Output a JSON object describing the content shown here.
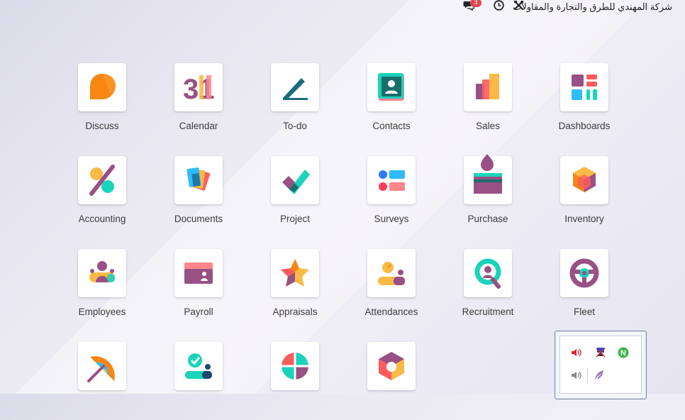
{
  "topbar": {
    "chat_badge": "3",
    "company_name": "شركة المهندي للطرق والتجارة والمقاولات"
  },
  "apps": [
    {
      "label": "Discuss"
    },
    {
      "label": "Calendar",
      "icon_text": "31"
    },
    {
      "label": "To-do"
    },
    {
      "label": "Contacts"
    },
    {
      "label": "Sales"
    },
    {
      "label": "Dashboards"
    },
    {
      "label": "Accounting"
    },
    {
      "label": "Documents"
    },
    {
      "label": "Project"
    },
    {
      "label": "Surveys"
    },
    {
      "label": "Purchase"
    },
    {
      "label": "Inventory"
    },
    {
      "label": "Employees"
    },
    {
      "label": "Payroll"
    },
    {
      "label": "Appraisals"
    },
    {
      "label": "Attendances"
    },
    {
      "label": "Recruitment"
    },
    {
      "label": "Fleet"
    },
    {
      "label": ""
    },
    {
      "label": ""
    },
    {
      "label": ""
    },
    {
      "label": ""
    }
  ],
  "tray": {
    "icons": [
      "speaker-icon",
      "network-icon",
      "n-app-icon",
      "volume-icon",
      "feather-icon"
    ]
  },
  "colors": {
    "badge": "#e0454f",
    "purple": "#985184",
    "orange": "#f78613",
    "teal": "#1ad3bb",
    "cyan": "#2ebcfa",
    "yellow": "#fbb945",
    "red": "#fc868b"
  }
}
